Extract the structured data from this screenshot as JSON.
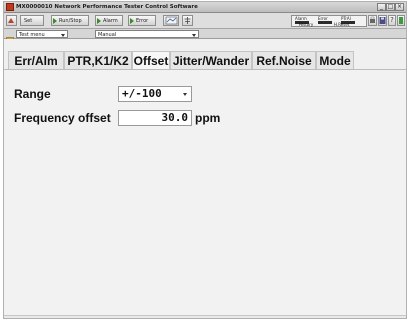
{
  "window": {
    "title": "MX0000010 Network Performance Tester Control Software"
  },
  "toolbar": {
    "run_stop_label": "Run/Stop",
    "alarm_label": "Alarm",
    "error_label": "Error",
    "status": {
      "alarm_label": "Alarm",
      "error_label": "Error",
      "ptrall_label": "PTrAl",
      "history_label": "History",
      "hfreset_label": "H.Reset"
    }
  },
  "modebar": {
    "test_menu_value": "Test menu",
    "mode_value": "Manual"
  },
  "tabs": [
    {
      "label": "Err/Alm"
    },
    {
      "label": "PTR,K1/K2"
    },
    {
      "label": "Offset"
    },
    {
      "label": "Jitter/Wander"
    },
    {
      "label": "Ref.Noise"
    },
    {
      "label": "Mode"
    }
  ],
  "offset": {
    "range_label": "Range",
    "range_value": "+/-100",
    "frequency_label": "Frequency offset",
    "frequency_value": "30.0",
    "frequency_unit": "ppm"
  }
}
